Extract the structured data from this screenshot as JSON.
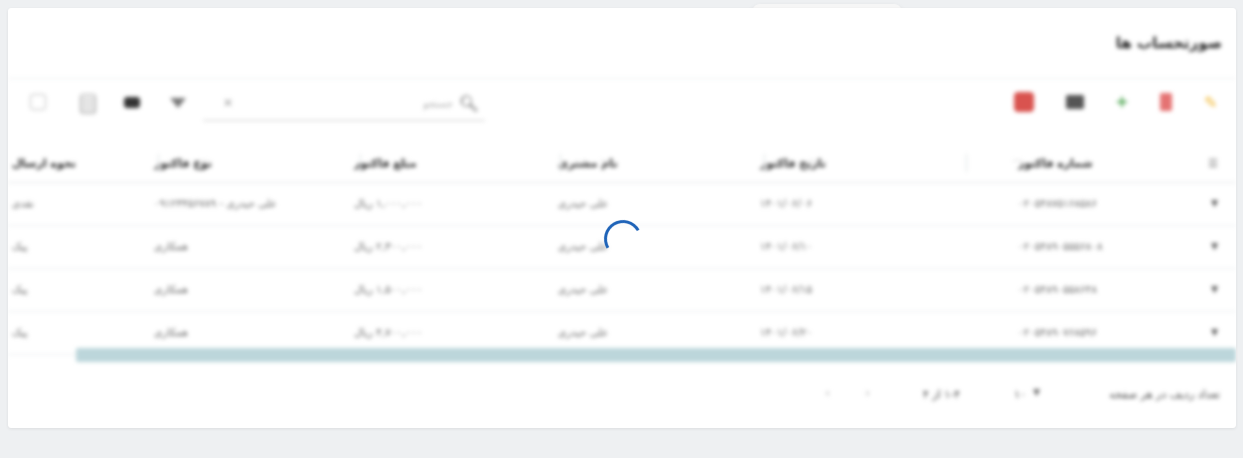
{
  "page": {
    "title": "صورتحساب ها"
  },
  "toolbar": {
    "search_placeholder": "جستجو",
    "search_icon": "search-icon",
    "clear_icon": "close-icon",
    "left_icons": [
      "grid-icon",
      "columns-icon",
      "density-icon",
      "filter-icon"
    ],
    "right_icons": [
      "pdf-icon",
      "video-icon",
      "add-icon",
      "delete-icon",
      "edit-icon"
    ],
    "colors": {
      "pdf": "#d9534f",
      "add": "#43a047",
      "delete": "#e57373",
      "edit": "#f0b429"
    }
  },
  "table": {
    "columns": [
      "شماره فاکتور",
      "تاریخ فاکتور",
      "نام مشتری",
      "مبلغ فاکتور",
      "نوع فاکتور",
      "نحوه ارسال"
    ],
    "rows": [
      [
        "۰۲۰۵۴۸۷۵۱۶۸۵۸۶",
        "۱۴۰۱/۰۶/۰۶",
        "علی حیدری",
        "۱,۰۰۰,۰۰۰ ریال",
        "علی حیدری - ۰۹۱۲۳۴۵۶۷۸۹",
        "نقدی"
      ],
      [
        "۰۲۰۵۴۸۹۰۵۵۵۶۸۰۸",
        "۱۴۰۱/۰۶/۱۰",
        "علی حیدری",
        "۲,۳۰۰,۰۰۰ ریال",
        "همکاری",
        "پیک"
      ],
      [
        "۰۲۰۵۴۸۹۰۵۵۸۶۴۸",
        "۱۴۰۱/۰۶/۱۵",
        "علی حیدری",
        "۱,۵۰۰,۰۰۰ ریال",
        "همکاری",
        "پیک"
      ],
      [
        "۰۲۰۵۴۸۹۰۷۶۸۵۹۶",
        "۱۴۰۱/۰۶/۲۰",
        "علی حیدری",
        "۴,۷۰۰,۰۰۰ ریال",
        "همکاری",
        "پیک"
      ]
    ]
  },
  "footer": {
    "rows_per_page_label": "تعداد ردیف در هر صفحه",
    "rows_per_page": "۱۰",
    "range": "۱-۴ از ۴",
    "prev": "‹",
    "next": "›"
  },
  "status": {
    "loading": true,
    "spinner_color": "#1e63b8"
  }
}
